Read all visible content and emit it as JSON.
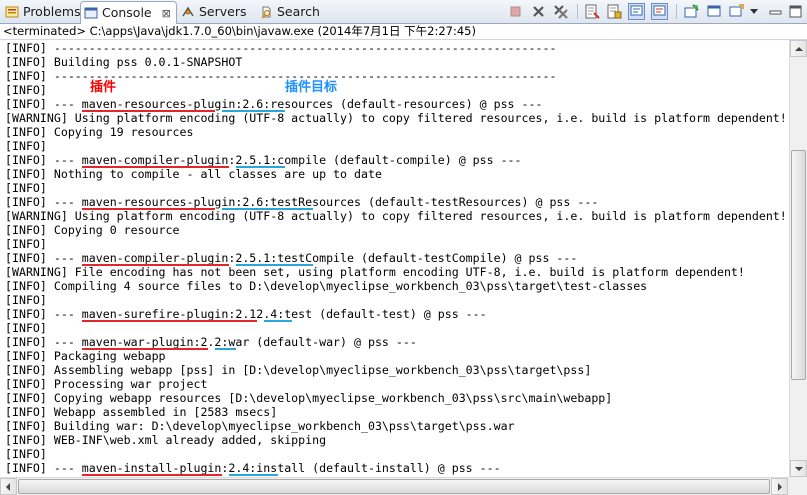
{
  "tabs": [
    {
      "label": "Problems",
      "icon": "problems-icon",
      "active": false
    },
    {
      "label": "Console",
      "icon": "console-icon",
      "active": true,
      "close": "⊠"
    },
    {
      "label": "Servers",
      "icon": "servers-icon",
      "active": false
    },
    {
      "label": "Search",
      "icon": "search-icon",
      "active": false
    }
  ],
  "toolbar": [
    {
      "name": "terminate-icon"
    },
    {
      "name": "remove-launch-icon"
    },
    {
      "name": "remove-all-terminated-icon"
    },
    {
      "name": "clear-console-icon"
    },
    {
      "name": "scroll-lock-icon"
    },
    {
      "name": "show-on-stdout-icon"
    },
    {
      "name": "show-on-stderr-icon"
    },
    {
      "name": "pin-console-icon"
    },
    {
      "name": "display-selected-console-icon"
    },
    {
      "name": "open-console-icon"
    },
    {
      "name": "view-menu-icon"
    },
    {
      "name": "minimize-icon"
    },
    {
      "name": "maximize-icon"
    }
  ],
  "status": "<terminated> C:\\apps\\Java\\jdk1.7.0_60\\bin\\javaw.exe (2014年7月1日 下午2:27:45)",
  "annotations": {
    "plugin": "插件",
    "plugin_goal": "插件目标"
  },
  "colors": {
    "annotation_red": "#ff0000",
    "annotation_blue": "#1e90ff",
    "underline_red": "#e3262b",
    "underline_blue": "#2aa7d8"
  },
  "console_lines": [
    "[INFO] ------------------------------------------------------------------------",
    "[INFO] Building pss 0.0.1-SNAPSHOT",
    "[INFO] ------------------------------------------------------------------------",
    "[INFO]",
    "[INFO] --- maven-resources-plugin:2.6:resources (default-resources) @ pss ---",
    "[WARNING] Using platform encoding (UTF-8 actually) to copy filtered resources, i.e. build is platform dependent!",
    "[INFO] Copying 19 resources",
    "[INFO]",
    "[INFO] --- maven-compiler-plugin:2.5.1:compile (default-compile) @ pss ---",
    "[INFO] Nothing to compile - all classes are up to date",
    "[INFO]",
    "[INFO] --- maven-resources-plugin:2.6:testResources (default-testResources) @ pss ---",
    "[WARNING] Using platform encoding (UTF-8 actually) to copy filtered resources, i.e. build is platform dependent!",
    "[INFO] Copying 0 resource",
    "[INFO]",
    "[INFO] --- maven-compiler-plugin:2.5.1:testCompile (default-testCompile) @ pss ---",
    "[WARNING] File encoding has not been set, using platform encoding UTF-8, i.e. build is platform dependent!",
    "[INFO] Compiling 4 source files to D:\\develop\\myeclipse_workbench_03\\pss\\target\\test-classes",
    "[INFO]",
    "[INFO] --- maven-surefire-plugin:2.12.4:test (default-test) @ pss ---",
    "[INFO]",
    "[INFO] --- maven-war-plugin:2.2:war (default-war) @ pss ---",
    "[INFO] Packaging webapp",
    "[INFO] Assembling webapp [pss] in [D:\\develop\\myeclipse_workbench_03\\pss\\target\\pss]",
    "[INFO] Processing war project",
    "[INFO] Copying webapp resources [D:\\develop\\myeclipse_workbench_03\\pss\\src\\main\\webapp]",
    "[INFO] Webapp assembled in [2583 msecs]",
    "[INFO] Building war: D:\\develop\\myeclipse_workbench_03\\pss\\target\\pss.war",
    "[INFO] WEB-INF\\web.xml already added, skipping",
    "[INFO]",
    "[INFO] --- maven-install-plugin:2.4:install (default-install) @ pss ---"
  ]
}
